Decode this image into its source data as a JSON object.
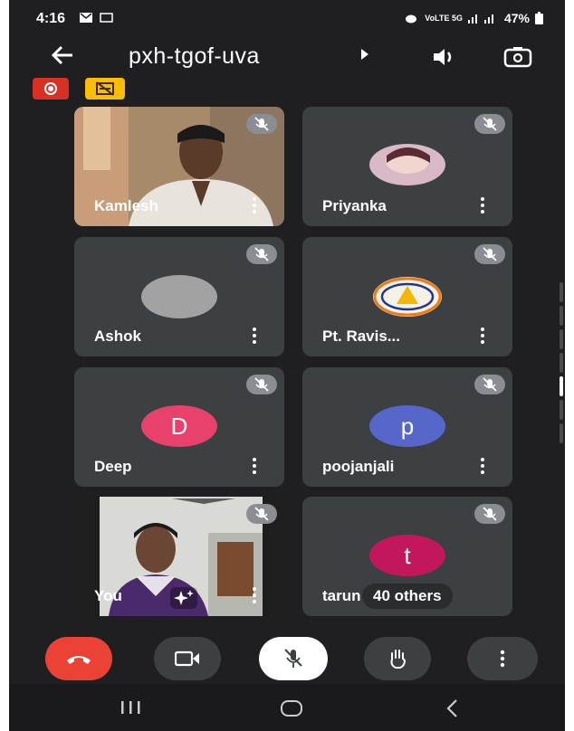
{
  "status_bar": {
    "time": "4:16",
    "network": "VoLTE 5G",
    "battery": "47%"
  },
  "meeting": {
    "code": "pxh-tgof-uva"
  },
  "participants": [
    {
      "name": "Kamlesh",
      "type": "video"
    },
    {
      "name": "Priyanka",
      "type": "photo"
    },
    {
      "name": "Ashok",
      "type": "blank"
    },
    {
      "name": "Pt. Ravis...",
      "type": "logo"
    },
    {
      "name": "Deep",
      "type": "letter",
      "letter": "D",
      "color": "#e8416b"
    },
    {
      "name": "poojanjali",
      "type": "letter",
      "letter": "p",
      "color": "#5767c9"
    },
    {
      "name": "You",
      "type": "self"
    },
    {
      "name": "tarun",
      "type": "letter",
      "letter": "t",
      "color": "#c2185b",
      "others": "40 others"
    }
  ],
  "controls": {
    "end_call": "end-call",
    "camera": "camera",
    "mic": "mic-off",
    "raise_hand": "raise-hand",
    "more": "more"
  },
  "colors": {
    "background": "#1f1f21",
    "tile": "#3c4043",
    "end_call": "#ea4335",
    "control": "#3c4043",
    "mic_active": "#ffffff"
  }
}
